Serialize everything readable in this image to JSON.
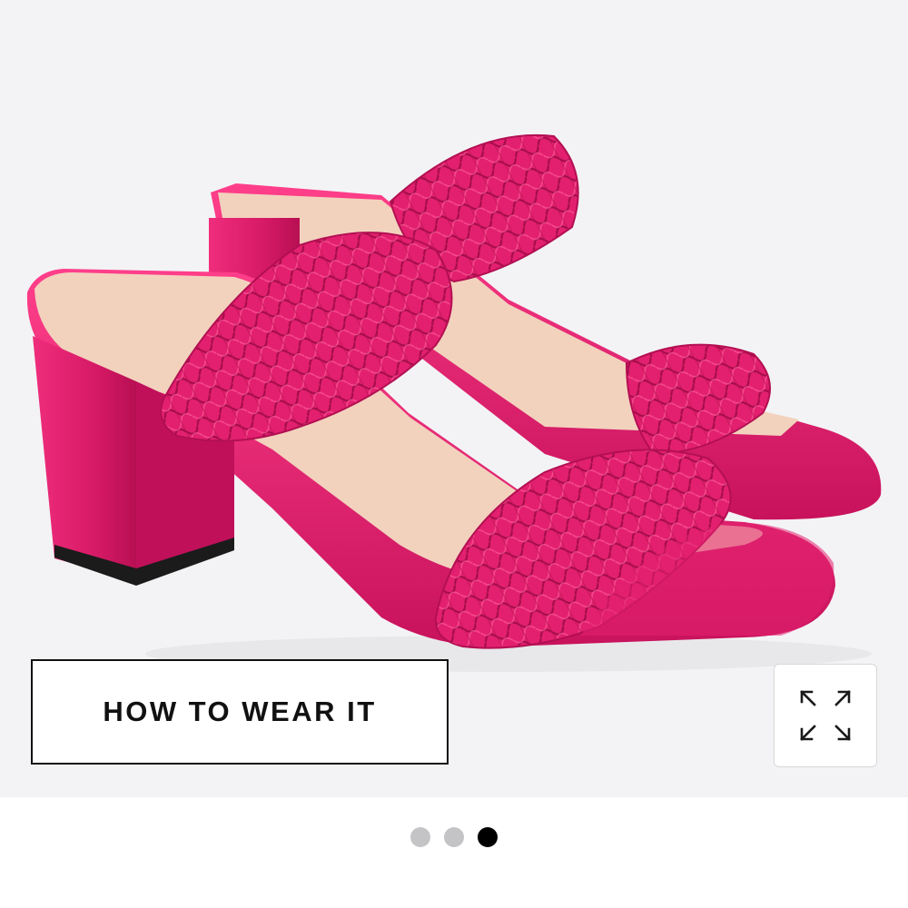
{
  "gallery": {
    "image_name": "pink-braided-block-heel-sandals",
    "how_to_wear_label": "HOW TO WEAR IT",
    "expand_icon": "expand-arrows-icon",
    "slides": [
      {
        "active": false
      },
      {
        "active": false
      },
      {
        "active": true
      }
    ]
  },
  "colors": {
    "background": "#f3f3f5",
    "sandal": "#e3206f",
    "footbed": "#f2d2bd",
    "active_dot": "#000000",
    "inactive_dot": "#c4c4c6"
  }
}
